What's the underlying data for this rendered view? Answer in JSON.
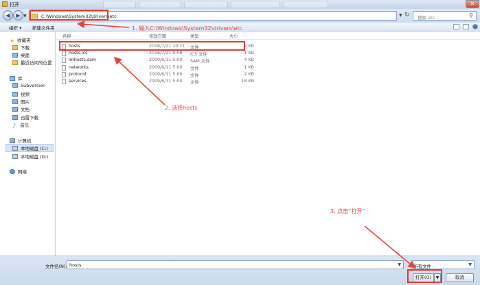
{
  "window": {
    "title": "打开"
  },
  "address": {
    "path": "C:\\Windows\\System32\\drivers\\etc"
  },
  "search": {
    "placeholder": "搜索 etc"
  },
  "toolbar": {
    "organize": "组织 ▾",
    "new_folder": "新建文件夹"
  },
  "sidebar": {
    "favorites": "收藏夹",
    "downloads": "下载",
    "desktop": "桌面",
    "recent": "最近访问的位置",
    "library": "库",
    "subversion": "Subversion",
    "videos": "视频",
    "pictures": "图片",
    "documents": "文档",
    "thunder": "迅雷下载",
    "music": "音乐",
    "computer": "计算机",
    "drive_c": "本地磁盘 (C:)",
    "drive_d": "本地磁盘 (D:)",
    "network": "网络"
  },
  "columns": {
    "name": "名称",
    "date": "修改日期",
    "type": "类型",
    "size": "大小"
  },
  "files": [
    {
      "name": "hosts",
      "date": "2016/7/21 10:11",
      "type": "文件",
      "size": "2 KB"
    },
    {
      "name": "hosts.ics",
      "date": "2016/7/21 9:58",
      "type": "ICS 文件",
      "size": "1 KB"
    },
    {
      "name": "lmhosts.sam",
      "date": "2009/6/11 5:00",
      "type": "SAM 文件",
      "size": "4 KB"
    },
    {
      "name": "networks",
      "date": "2009/6/11 5:00",
      "type": "文件",
      "size": "1 KB"
    },
    {
      "name": "protocol",
      "date": "2009/6/11 5:00",
      "type": "文件",
      "size": "2 KB"
    },
    {
      "name": "services",
      "date": "2009/6/11 5:00",
      "type": "文件",
      "size": "18 KB"
    }
  ],
  "bottom": {
    "filename_label": "文件名(N):",
    "filename_value": "hosts",
    "filter": "所有文件",
    "open": "打开(O)",
    "cancel": "取消"
  },
  "annotations": {
    "step1": "1. 输入C:\\Windows\\System32\\drivers\\etc",
    "step2": "2. 选择hosts",
    "step3": "3. 点击“打开”",
    "color": "#e8433a"
  }
}
